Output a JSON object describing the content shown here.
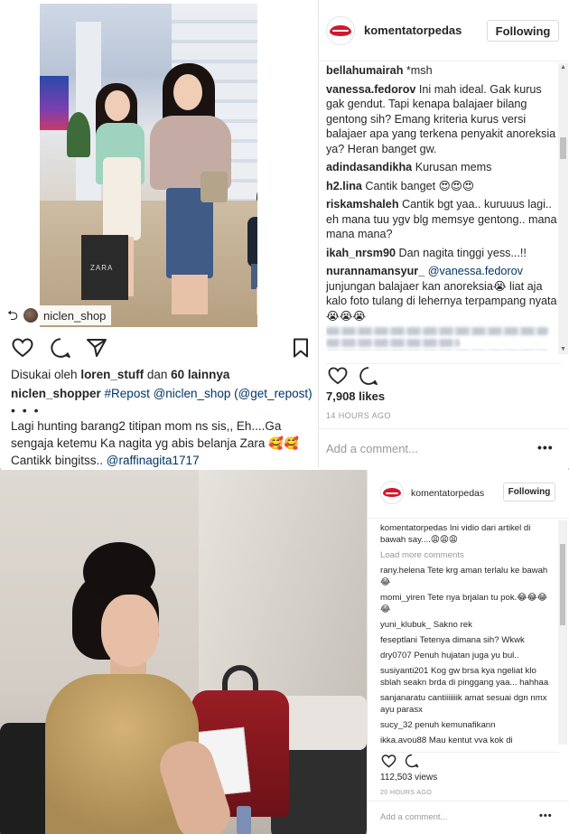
{
  "top_post": {
    "repost_badge": {
      "icon": "repost-icon",
      "username": "niclen_shop"
    },
    "photo_bag_text": "ZARA",
    "likes_prefix": "Disukai oleh",
    "likes_user": "loren_stuff",
    "likes_connector": "dan",
    "likes_others": "60 lainnya",
    "caption_user": "niclen_shopper",
    "caption_line1": "#Repost @niclen_shop (@get_repost)",
    "caption_dots": "• • •",
    "caption_line2": "Lagi hunting barang2 titipan mom ns sis,, Eh....Ga",
    "caption_line3": "sengaja ketemu Ka nagita yg abis belanja Zara 🥰🥰",
    "caption_line4_text": "Cantikk bingitss.. ",
    "caption_line4_mention": "@raffinagita1717"
  },
  "web_panel_top": {
    "username": "komentatorpedas",
    "follow_label": "Following",
    "comments": [
      {
        "user": "bellahumairah",
        "text": "*msh",
        "mention": ""
      },
      {
        "user": "vanessa.fedorov",
        "text": "Ini mah ideal. Gak kurus gak gendut. Tapi kenapa balajaer bilang gentong sih? Emang kriteria kurus versi balajaer apa yang terkena penyakit anoreksia ya? Heran banget gw.",
        "mention": ""
      },
      {
        "user": "adindasandikha",
        "text": "Kurusan mems",
        "mention": ""
      },
      {
        "user": "h2.lina",
        "text": "Cantik banget 😍😍😍",
        "mention": ""
      },
      {
        "user": "riskamshaleh",
        "text": "Cantik bgt yaa.. kuruuus lagi.. eh mana tuu ygv blg memsye gentong.. mana mana mana?",
        "mention": ""
      },
      {
        "user": "ikah_nrsm90",
        "text": "Dan nagita tinggi yess...!!",
        "mention": ""
      },
      {
        "user": "nurannamansyur_",
        "text": "junjungan balajaer kan anoreksia😭 liat aja kalo foto tulang di lehernya terpampang nyata😭😭😭",
        "mention": "@vanessa.fedorov"
      }
    ],
    "likes": "7,908 likes",
    "timestamp": "14 HOURS AGO",
    "add_comment_placeholder": "Add a comment...",
    "more_label": "•••"
  },
  "web_panel_bottom": {
    "username": "komentatorpedas",
    "follow_label": "Following",
    "caption_user": "komentatorpedas",
    "caption_text": "Ini vidio dari artikel di bawah say....😩😩😩",
    "load_more": "Load more comments",
    "comments": [
      {
        "user": "rany.helena",
        "text": "Tete krg aman terlalu ke bawah 😂"
      },
      {
        "user": "momi_yiren",
        "text": "Tete nya brjalan tu pok.😂😂😂😂"
      },
      {
        "user": "yuni_klubuk_",
        "text": "Sakno rek"
      },
      {
        "user": "feseptlani",
        "text": "Tetenya dimana sih? Wkwk"
      },
      {
        "user": "dry0707",
        "text": "Penuh hujatan juga yu bul.."
      },
      {
        "user": "susiyanti201",
        "text": "Kog gw brsa kya ngeliat klo sblah seakn brda di pinggang yaa... hahhaa"
      },
      {
        "user": "sanjanaratu",
        "text": "cantiiiiiiik amat sesuai dgn nmx ayu parasx"
      },
      {
        "user": "sucy_32",
        "text": "penuh kemunafikann"
      },
      {
        "user": "ikka.ayou88",
        "text": "Mau kentut yya kok di"
      }
    ],
    "views": "112,503 views",
    "timestamp": "20 HOURS AGO",
    "add_comment_placeholder": "Add a comment...",
    "more_label": "•••"
  },
  "colors": {
    "text": "#262626",
    "muted": "#999999",
    "link": "#003569",
    "brand_red": "#d0192c"
  }
}
